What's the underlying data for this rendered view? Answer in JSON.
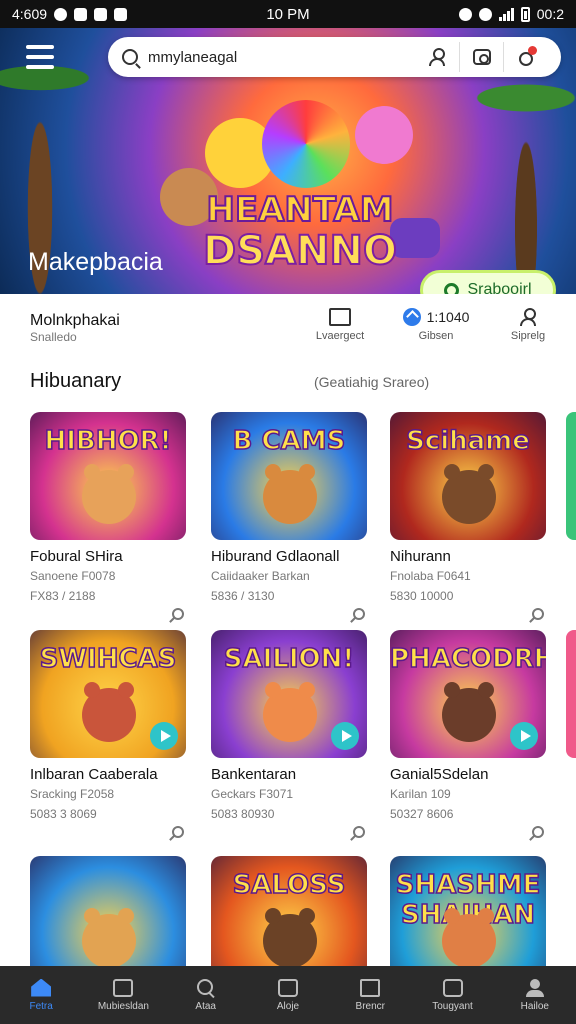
{
  "status_bar": {
    "left_text": "4:609",
    "time": "10 PM",
    "right_text": "00:2"
  },
  "search": {
    "value": "mmylaneagal"
  },
  "hero": {
    "title": "Makepbacia",
    "logo_line1": "HEANTAM",
    "logo_line2": "DSANNO",
    "button_label": "Srabooirl"
  },
  "profile": {
    "name": "Molnkphakai",
    "subtitle": "Snalledo",
    "stats": [
      {
        "label": "Lvaergect",
        "icon": "tv-icon"
      },
      {
        "value": "1:1040",
        "label": "Gibsen",
        "icon": "verified-badge-icon"
      },
      {
        "label": "Siprelg",
        "icon": "user-icon"
      }
    ]
  },
  "section": {
    "title": "Hibuanary",
    "subtitle": "(Geatiahig Srareo)"
  },
  "cards": [
    {
      "art": "HIBHOR!",
      "title": "Fobural SHira",
      "subtitle": "Sanoene F0078",
      "meta": "FX83 / 2188",
      "bg": "#d4328f",
      "char": "#e7a25a"
    },
    {
      "art": "B CAMS",
      "title": "Hiburand Gdlaonall",
      "subtitle": "Caiidaaker Barkan",
      "meta": "5836 / 3130",
      "bg": "#2a7be6",
      "char": "#d98a3e"
    },
    {
      "art": "Scihame",
      "title": "Nihurann",
      "subtitle": "Fnolaba F0641",
      "meta": "5830 10000",
      "bg": "#b0281e",
      "char": "#7a4b2a"
    },
    {
      "art": "SWIHCAS",
      "title": "Inlbaran Caaberala",
      "subtitle": "Sracking F2058",
      "meta": "5083 3 8069",
      "bg": "#f0a321",
      "char": "#c9553b"
    },
    {
      "art": "SAILION!",
      "title": "Bankentaran",
      "subtitle": "Geckars F3071",
      "meta": "5083 80930",
      "bg": "#8a3fd0",
      "char": "#ef8b4a"
    },
    {
      "art": "PHACODRH",
      "title": "Ganial5Sdelan",
      "subtitle": "Karilan 109",
      "meta": "50327 8606",
      "bg": "#c63aa0",
      "char": "#6b3d2a"
    },
    {
      "art": "",
      "title": "",
      "subtitle": "",
      "meta": "",
      "bg": "#2c8ee0",
      "char": "#e2a352"
    },
    {
      "art": "SALOSS",
      "title": "",
      "subtitle": "",
      "meta": "",
      "bg": "#e4571f",
      "char": "#6b4226"
    },
    {
      "art": "SHASHME SHAIHAN",
      "title": "",
      "subtitle": "",
      "meta": "",
      "bg": "#1f9ed8",
      "char": "#e07f45"
    }
  ],
  "nav": [
    {
      "label": "Fetra",
      "icon": "home-icon"
    },
    {
      "label": "Mubiesldan",
      "icon": "grid-icon"
    },
    {
      "label": "Ataa",
      "icon": "search-icon"
    },
    {
      "label": "Aloje",
      "icon": "bag-icon"
    },
    {
      "label": "Brencr",
      "icon": "box-icon"
    },
    {
      "label": "Tougyant",
      "icon": "frame-icon"
    },
    {
      "label": "Hailoe",
      "icon": "user-icon"
    }
  ],
  "colors": {
    "accent": "#3d8af7",
    "hero_button_text": "#1d6b2a",
    "nav_bg": "#2a2a2a"
  }
}
